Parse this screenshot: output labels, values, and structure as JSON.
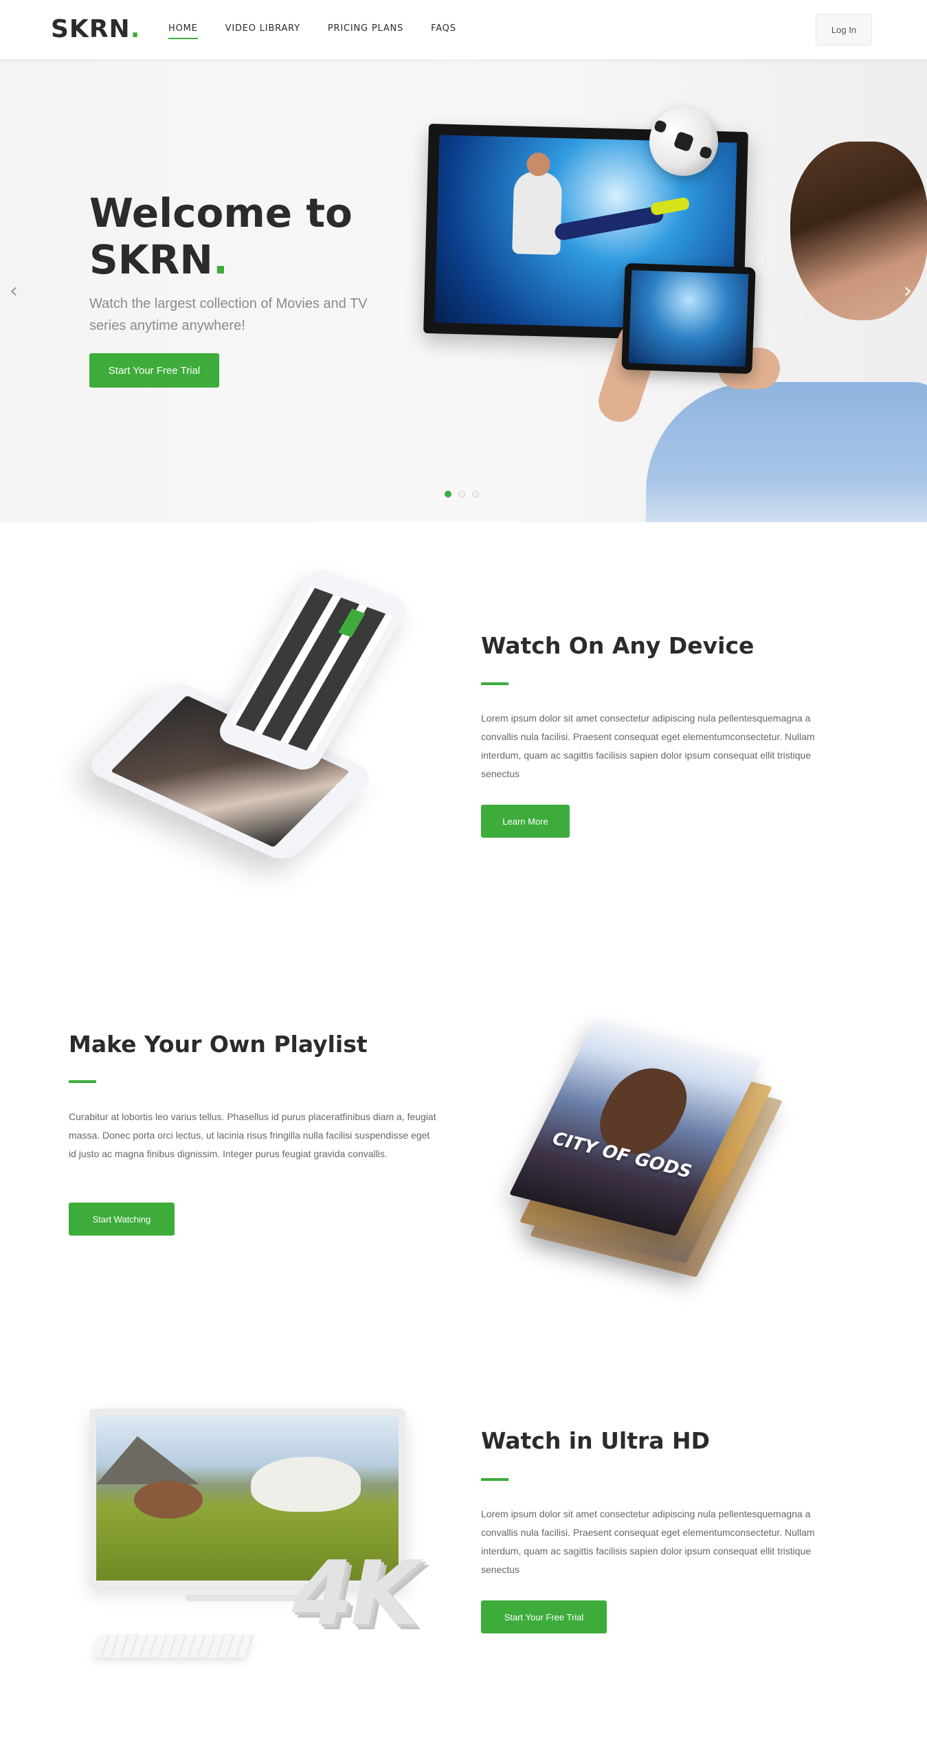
{
  "brand": {
    "name": "SKRN",
    "dot": ".",
    "accent_color": "#3dac3b"
  },
  "nav": {
    "items": [
      {
        "label": "HOME",
        "active": true
      },
      {
        "label": "VIDEO LIBRARY",
        "active": false
      },
      {
        "label": "PRICING PLANS",
        "active": false
      },
      {
        "label": "FAQS",
        "active": false
      }
    ],
    "login_label": "Log In"
  },
  "hero": {
    "title": "Welcome to SKRN",
    "title_line1": "Welcome to",
    "title_line2": "SKRN",
    "subtitle": "Watch the largest collection of Movies and TV series anytime anywhere!",
    "cta_label": "Start Your Free Trial",
    "prev_icon": "chevron-left-icon",
    "next_icon": "chevron-right-icon",
    "slides_total": 3,
    "active_slide": 1
  },
  "features": [
    {
      "title": "Watch On Any Device",
      "text": "Lorem ipsum dolor sit amet consectetur adipiscing nula pellentesquemagna a convallis nula facilisi. Praesent consequat eget elementumconsectetur. Nullam interdum, quam ac sagittis facilisis sapien dolor ipsum consequat ellit tristique senectus",
      "button": "Learn More"
    },
    {
      "title": "Make Your Own Playlist",
      "text": "Curabitur at lobortis leo varius tellus. Phasellus id purus placeratfinibus diam a, feugiat massa. Donec porta orci lectus, ut lacinia risus fringilla nulla facilisi suspendisse eget id justo ac magna finibus dignissim. Integer purus feugiat gravida convallis.",
      "button": "Start Watching",
      "poster_title": "CITY OF GODS"
    },
    {
      "title": "Watch in Ultra HD",
      "text": "Lorem ipsum dolor sit amet consectetur adipiscing nula pellentesquemagna a convallis nula facilisi. Praesent consequat eget elementumconsectetur. Nullam interdum, quam ac sagittis facilisis sapien dolor ipsum consequat ellit tristique senectus",
      "button": "Start Your Free Trial",
      "badge": "4K"
    }
  ]
}
